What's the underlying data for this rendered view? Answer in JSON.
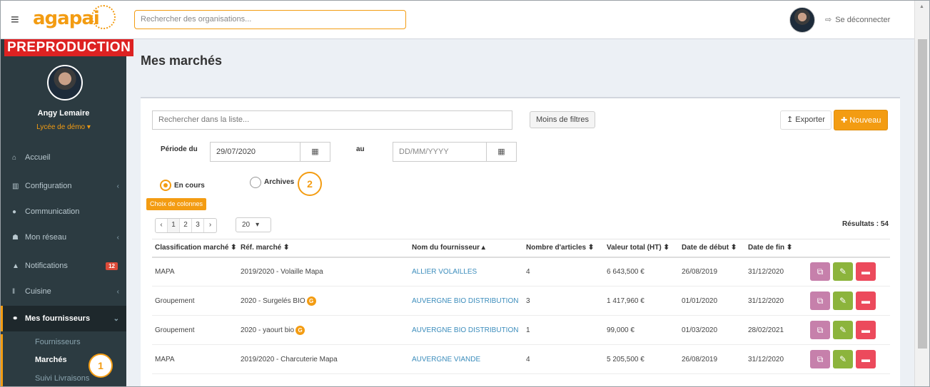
{
  "app": {
    "logo": "agapai",
    "env_badge": "PREPRODUCTION"
  },
  "topbar": {
    "search_placeholder": "Rechercher des organisations...",
    "logout_label": "Se déconnecter"
  },
  "user": {
    "name": "Angy Lemaire",
    "org": "Lycée de démo ▾"
  },
  "sidebar": {
    "items": [
      {
        "label": "Accueil",
        "icon": "home-icon"
      },
      {
        "label": "Configuration",
        "icon": "bank-icon"
      },
      {
        "label": "Communication",
        "icon": "chat-icon"
      },
      {
        "label": "Mon réseau",
        "icon": "users-icon"
      },
      {
        "label": "Notifications",
        "icon": "bell-icon",
        "badge": "12"
      },
      {
        "label": "Cuisine",
        "icon": "cutlery-icon"
      },
      {
        "label": "Mes fournisseurs",
        "icon": "handshake-icon"
      }
    ],
    "sub_items": [
      "Fournisseurs",
      "Marchés",
      "Suivi Livraisons"
    ]
  },
  "page": {
    "title": "Mes marchés"
  },
  "toolbar": {
    "search_placeholder": "Rechercher dans la liste...",
    "less_filters": "Moins de filtres",
    "export": "Exporter",
    "new": "Nouveau"
  },
  "filters": {
    "period_label": "Période du",
    "from_value": "29/07/2020",
    "to_label": "au",
    "to_placeholder": "DD/MM/YYYY",
    "radio_current": "En cours",
    "radio_archives": "Archives",
    "columns_button": "Choix de colonnes"
  },
  "markers": [
    "1",
    "2"
  ],
  "pagination": {
    "prev": "‹",
    "pages": [
      "1",
      "2",
      "3"
    ],
    "next": "›",
    "per_page": "20",
    "results": "Résultats : 54"
  },
  "table": {
    "headers": [
      "Classification marché ⬍",
      "Réf. marché ⬍",
      "Nom du fournisseur ▴",
      "Nombre d'articles ⬍",
      "Valeur total (HT) ⬍",
      "Date de début ⬍",
      "Date de fin ⬍"
    ],
    "rows": [
      {
        "classification": "MAPA",
        "ref": "2019/2020 - Volaille Mapa",
        "badge": "",
        "supplier": "ALLIER VOLAILLES",
        "articles": "4",
        "value": "6 643,500 €",
        "start": "26/08/2019",
        "end": "31/12/2020"
      },
      {
        "classification": "Groupement",
        "ref": "2020 - Surgelés BIO",
        "badge": "G",
        "supplier": "AUVERGNE BIO DISTRIBUTION",
        "articles": "3",
        "value": "1 417,960 €",
        "start": "01/01/2020",
        "end": "31/12/2020"
      },
      {
        "classification": "Groupement",
        "ref": "2020 - yaourt bio",
        "badge": "G",
        "supplier": "AUVERGNE BIO DISTRIBUTION",
        "articles": "1",
        "value": "99,000 €",
        "start": "01/03/2020",
        "end": "28/02/2021"
      },
      {
        "classification": "MAPA",
        "ref": "2019/2020 - Charcuterie Mapa",
        "badge": "",
        "supplier": "AUVERGNE VIANDE",
        "articles": "4",
        "value": "5 205,500 €",
        "start": "26/08/2019",
        "end": "31/12/2020"
      }
    ]
  },
  "colors": {
    "accent": "#f39c12",
    "sidebar": "#2c3b41",
    "link": "#3c8dbc",
    "copy": "#c680ab",
    "edit": "#8cb43c",
    "delete": "#ec4a5c"
  }
}
